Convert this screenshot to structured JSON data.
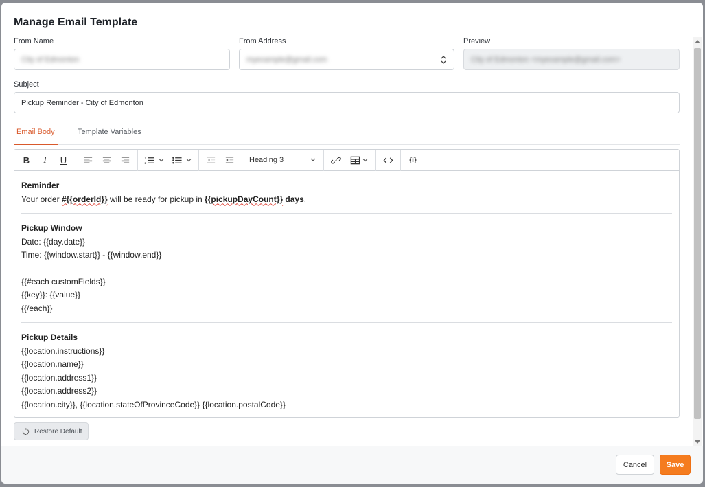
{
  "dialog": {
    "title": "Manage Email Template"
  },
  "fields": {
    "from_name": {
      "label": "From Name",
      "value": "City of Edmonton"
    },
    "from_address": {
      "label": "From Address",
      "value": "myexample@gmail.com"
    },
    "preview": {
      "label": "Preview",
      "value": "City of Edmonton <myexample@gmail.com>"
    },
    "subject": {
      "label": "Subject",
      "value": "Pickup Reminder - City of Edmonton"
    }
  },
  "tabs": [
    {
      "label": "Email Body",
      "active": true
    },
    {
      "label": "Template Variables",
      "active": false
    }
  ],
  "toolbar": {
    "heading_value": "Heading 3"
  },
  "body": {
    "reminder_heading": "Reminder",
    "reminder_line_pre": "Your order ",
    "order_token": "#{{orderId}}",
    "reminder_mid": " will be ready for pickup in ",
    "days_token": "{{pickupDayCount}}",
    "days_word": " days",
    "period": ".",
    "window_heading": "Pickup Window",
    "date_line": "Date: {{day.date}}",
    "time_line": "Time: {{window.start}} - {{window.end}}",
    "each_open": "{{#each customFields}}",
    "key_value": "{{key}}: {{value}}",
    "each_close": "{{/each}}",
    "details_heading": "Pickup Details",
    "loc_instructions": "{{location.instructions}}",
    "loc_name": "{{location.name}}",
    "loc_address1": "{{location.address1}}",
    "loc_address2": "{{location.address2}}",
    "loc_city_line": "{{location.city}}, {{location.stateOfProvinceCode}} {{location.postalCode}}"
  },
  "actions": {
    "restore_label": "Restore Default",
    "cancel_label": "Cancel",
    "save_label": "Save"
  },
  "colors": {
    "accent": "#f57c1f",
    "active_tab": "#d9592b"
  }
}
